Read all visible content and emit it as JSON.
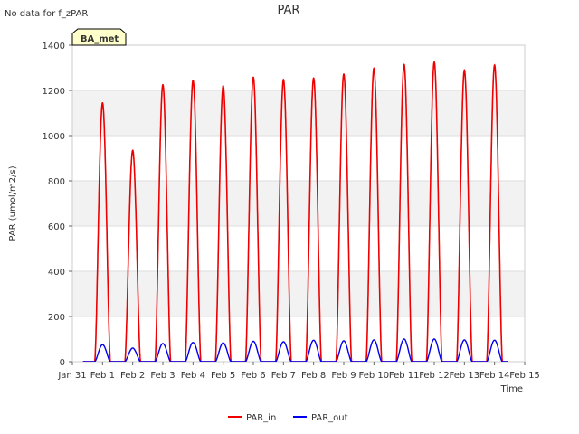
{
  "corner_note": "No data for f_zPAR",
  "site_badge": "BA_met",
  "chart_data": {
    "type": "line",
    "title": "PAR",
    "xlabel": "Time",
    "ylabel": "PAR (umol/m2/s)",
    "ylim": [
      0,
      1400
    ],
    "xlim_days": [
      0,
      15
    ],
    "y_ticks": [
      0,
      200,
      400,
      600,
      800,
      1000,
      1200,
      1400
    ],
    "x_tick_labels": [
      "Jan 31",
      "Feb 1",
      "Feb 2",
      "Feb 3",
      "Feb 4",
      "Feb 5",
      "Feb 6",
      "Feb 7",
      "Feb 8",
      "Feb 9",
      "Feb 10",
      "Feb 11",
      "Feb 12",
      "Feb 13",
      "Feb 14",
      "Feb 15"
    ],
    "grid": true,
    "legend": "bottom-center",
    "series": [
      {
        "name": "PAR_in",
        "color": "#ee0000",
        "daily_peak_day": [
          1.0,
          2.0,
          3.0,
          4.0,
          5.0,
          6.0,
          7.0,
          8.0,
          9.0,
          10.0,
          11.0,
          12.0,
          13.0,
          14.0
        ],
        "daily_peak_value": [
          1145,
          935,
          1225,
          1245,
          1220,
          1258,
          1248,
          1255,
          1272,
          1298,
          1315,
          1325,
          1290,
          1312
        ]
      },
      {
        "name": "PAR_out",
        "color": "#0000ee",
        "daily_peak_day": [
          1.0,
          2.0,
          3.0,
          4.0,
          5.0,
          6.0,
          7.0,
          8.0,
          9.0,
          10.0,
          11.0,
          12.0,
          13.0,
          14.0
        ],
        "daily_peak_value": [
          75,
          60,
          80,
          85,
          83,
          90,
          88,
          95,
          92,
          96,
          100,
          100,
          96,
          95
        ]
      }
    ]
  }
}
